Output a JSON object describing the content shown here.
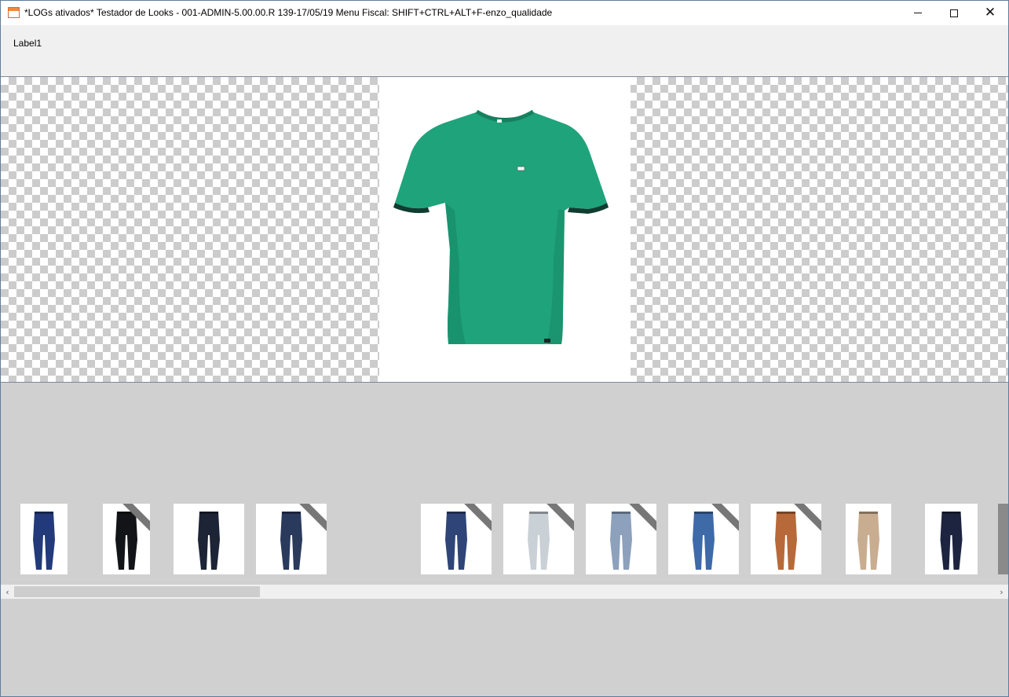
{
  "window": {
    "title": "*LOGs ativados* Testador de Looks - 001-ADMIN-5.00.00.R 139-17/05/19 Menu Fiscal: SHIFT+CTRL+ALT+F-enzo_qualidade"
  },
  "form": {
    "label": "Label1"
  },
  "preview": {
    "item": "green-tshirt",
    "color": "#1fa37a"
  },
  "thumbnails": [
    {
      "item": "jeans",
      "color": "#233a7a",
      "ribbon": false
    },
    {
      "item": "jeans",
      "color": "#121418",
      "ribbon": true
    },
    {
      "item": "jeans",
      "color": "#1c2436",
      "ribbon": false
    },
    {
      "item": "jeans",
      "color": "#2a3a5c",
      "ribbon": true
    },
    {
      "item": "jeans",
      "color": "#2f4577",
      "ribbon": true
    },
    {
      "item": "jeans",
      "color": "#c9d0d6",
      "ribbon": true
    },
    {
      "item": "jeans",
      "color": "#8da1bd",
      "ribbon": true
    },
    {
      "item": "jeans",
      "color": "#3f6aa8",
      "ribbon": true
    },
    {
      "item": "pants",
      "color": "#b8693a",
      "ribbon": true
    },
    {
      "item": "pants",
      "color": "#c9ad90",
      "ribbon": false
    },
    {
      "item": "jeans",
      "color": "#1d2440",
      "ribbon": false
    }
  ],
  "colors": {
    "window_border": "#5f7c9b",
    "background": "#d0d0d0",
    "toolbar": "#f0f0f0"
  }
}
